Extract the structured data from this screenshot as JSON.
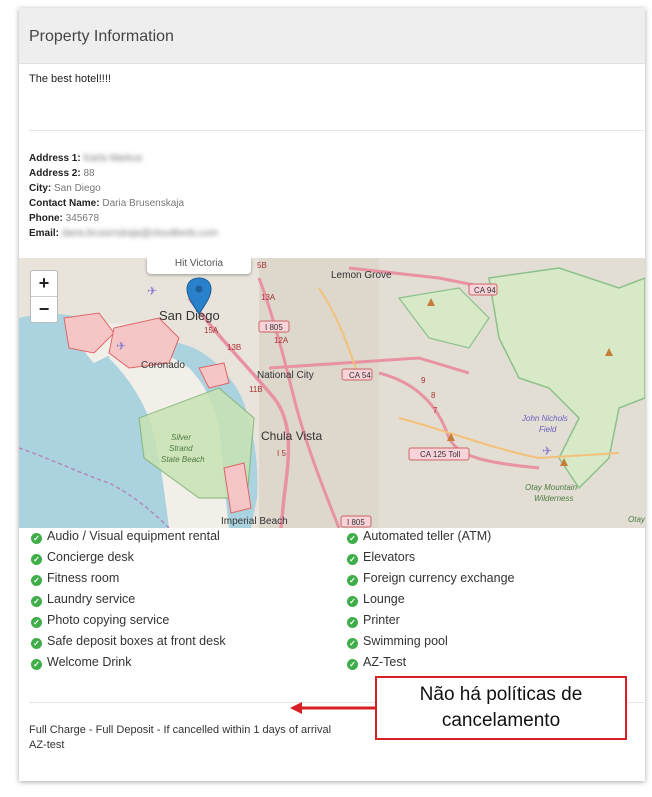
{
  "card": {
    "title": "Property Information"
  },
  "description": "The best hotel!!!!",
  "details": {
    "address1": {
      "label": "Address 1:",
      "value": "Karla Markus"
    },
    "address2": {
      "label": "Address 2:",
      "value": "88"
    },
    "city": {
      "label": "City:",
      "value": "San Diego"
    },
    "contact": {
      "label": "Contact Name:",
      "value": "Daria Brusenskaja"
    },
    "phone": {
      "label": "Phone:",
      "value": "345678"
    },
    "email": {
      "label": "Email:",
      "value": "daria.brusenskaja@cloudbeds.com"
    }
  },
  "map": {
    "zoom_in": "+",
    "zoom_out": "−",
    "popup": "Hit Victoria",
    "labels": [
      "San Diego",
      "Lemon Grove",
      "Coronado",
      "National City",
      "Chula Vista",
      "Silver Strand State Beach",
      "Imperial Beach",
      "John Nichols Field",
      "Otay Mountain Wilderness",
      "Otay",
      "CA 94",
      "I 805",
      "CA 54",
      "CA 125 Toll",
      "5B",
      "13A",
      "13B",
      "15A",
      "11B",
      "12A",
      "I 5",
      "9",
      "8",
      "7",
      "I 805"
    ]
  },
  "amenities": {
    "left": [
      "Audio / Visual equipment rental",
      "Concierge desk",
      "Fitness room",
      "Laundry service",
      "Photo copying service",
      "Safe deposit boxes at front desk",
      "Welcome Drink"
    ],
    "right": [
      "Automated teller (ATM)",
      "Elevators",
      "Foreign currency exchange",
      "Lounge",
      "Printer",
      "Swimming pool",
      "AZ-Test"
    ]
  },
  "policy": {
    "line1": "Full Charge - Full Deposit - If cancelled within 1 days of arrival",
    "line2": "AZ-test"
  },
  "callout": {
    "line1": "Não há políticas de",
    "line2": "cancelamento"
  },
  "colors": {
    "check": "#3fae49",
    "callout_border": "#d81f26",
    "map_marker": "#2a81cb"
  }
}
